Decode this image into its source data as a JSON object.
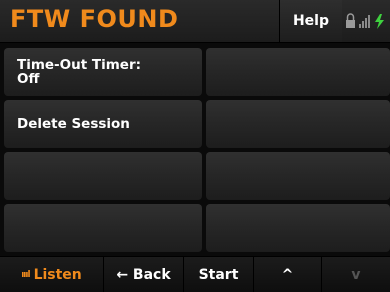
{
  "header": {
    "title": "FTW FOUND",
    "help_label": "Help",
    "accent_color": "#f08a1c",
    "status_icons": [
      "lock-icon",
      "signal-strength-icon",
      "battery-charging-icon"
    ]
  },
  "menu": {
    "items": [
      {
        "line1": "Time-Out Timer:",
        "line2": "Off"
      },
      {
        "line1": "",
        "line2": ""
      },
      {
        "line1": "Delete Session",
        "line2": ""
      },
      {
        "line1": "",
        "line2": ""
      },
      {
        "line1": "",
        "line2": ""
      },
      {
        "line1": "",
        "line2": ""
      },
      {
        "line1": "",
        "line2": ""
      },
      {
        "line1": "",
        "line2": ""
      }
    ]
  },
  "footer": {
    "listen_label": "Listen",
    "back_label": "← Back",
    "start_label": "Start",
    "up_label": "^",
    "down_label": "v"
  }
}
